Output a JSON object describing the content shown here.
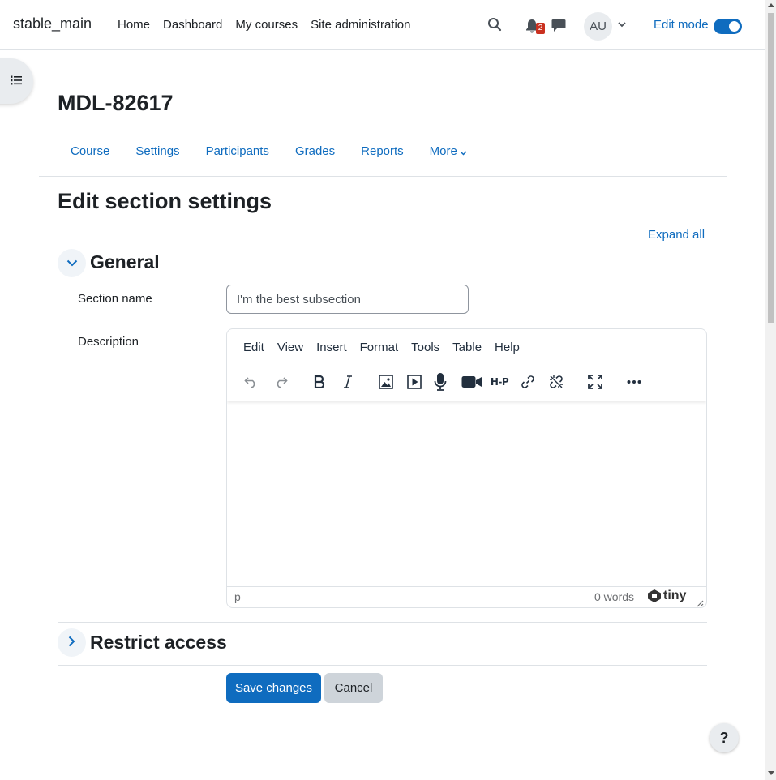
{
  "site": {
    "name": "stable_main"
  },
  "primary_nav": [
    "Home",
    "Dashboard",
    "My courses",
    "Site administration"
  ],
  "notifications": {
    "count": "2"
  },
  "user": {
    "initials": "AU"
  },
  "edit_mode": {
    "label": "Edit mode",
    "on": true
  },
  "course": {
    "title": "MDL-82617"
  },
  "secondary_nav": [
    "Course",
    "Settings",
    "Participants",
    "Grades",
    "Reports",
    "More"
  ],
  "page": {
    "title": "Edit section settings",
    "expand_all": "Expand all"
  },
  "general": {
    "title": "General",
    "section_name_label": "Section name",
    "section_name_value": "I'm the best subsection",
    "description_label": "Description"
  },
  "editor": {
    "menus": [
      "Edit",
      "View",
      "Insert",
      "Format",
      "Tools",
      "Table",
      "Help"
    ],
    "toolbar": [
      "undo-icon",
      "redo-icon",
      "bold-icon",
      "italic-icon",
      "image-icon",
      "media-icon",
      "microphone-icon",
      "video-camera-icon",
      "h5p-icon",
      "link-icon",
      "unlink-icon",
      "fullscreen-icon",
      "more-icon"
    ],
    "h5p_text": "H-P",
    "status_path": "p",
    "word_count": "0 words",
    "brand": "tiny"
  },
  "restrict": {
    "title": "Restrict access"
  },
  "buttons": {
    "save": "Save changes",
    "cancel": "Cancel"
  },
  "help": {
    "label": "?"
  },
  "colors": {
    "primary": "#0f6cbf",
    "badge": "#ca3120"
  }
}
